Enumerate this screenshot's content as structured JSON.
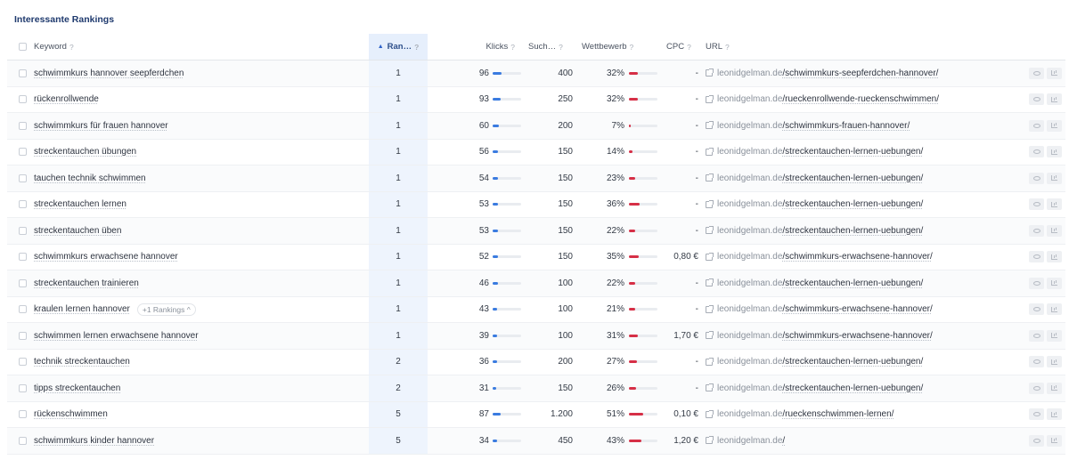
{
  "panel": {
    "title": "Interessante Rankings"
  },
  "columns": {
    "keyword": "Keyword",
    "rank": "Ran…",
    "clicks": "Klicks",
    "search": "Such…",
    "competition": "Wettbewerb",
    "cpc": "CPC",
    "url": "URL",
    "help": "?",
    "sort_icon": "▲"
  },
  "colors": {
    "rank_column": "#eef4fd",
    "clicks_bar": "#3a7be0",
    "competition_bar": "#d62f46",
    "title": "#1f3a6e"
  },
  "icons": {
    "sort": "sort-ascending-icon",
    "url": "external-link-icon",
    "view": "eye-icon",
    "stats": "chart-icon"
  },
  "rows": [
    {
      "keyword": "schwimmkurs hannover seepferdchen",
      "rank": "1",
      "clicks": "96",
      "clicks_pct": 0.3,
      "search": "400",
      "competition": "32%",
      "comp_pct": 0.32,
      "cpc": "-",
      "url_domain": "leonidgelman.de",
      "url_path": "/schwimmkurs-seepferdchen-hannover/"
    },
    {
      "keyword": "rückenrollwende",
      "rank": "1",
      "clicks": "93",
      "clicks_pct": 0.29,
      "search": "250",
      "competition": "32%",
      "comp_pct": 0.32,
      "cpc": "-",
      "url_domain": "leonidgelman.de",
      "url_path": "/rueckenrollwende-rueckenschwimmen/"
    },
    {
      "keyword": "schwimmkurs für frauen hannover",
      "rank": "1",
      "clicks": "60",
      "clicks_pct": 0.22,
      "search": "200",
      "competition": "7%",
      "comp_pct": 0.07,
      "cpc": "-",
      "url_domain": "leonidgelman.de",
      "url_path": "/schwimmkurs-frauen-hannover/"
    },
    {
      "keyword": "streckentauchen übungen",
      "rank": "1",
      "clicks": "56",
      "clicks_pct": 0.2,
      "search": "150",
      "competition": "14%",
      "comp_pct": 0.14,
      "cpc": "-",
      "url_domain": "leonidgelman.de",
      "url_path": "/streckentauchen-lernen-uebungen/"
    },
    {
      "keyword": "tauchen technik schwimmen",
      "rank": "1",
      "clicks": "54",
      "clicks_pct": 0.2,
      "search": "150",
      "competition": "23%",
      "comp_pct": 0.23,
      "cpc": "-",
      "url_domain": "leonidgelman.de",
      "url_path": "/streckentauchen-lernen-uebungen/"
    },
    {
      "keyword": "streckentauchen lernen",
      "rank": "1",
      "clicks": "53",
      "clicks_pct": 0.2,
      "search": "150",
      "competition": "36%",
      "comp_pct": 0.36,
      "cpc": "-",
      "url_domain": "leonidgelman.de",
      "url_path": "/streckentauchen-lernen-uebungen/"
    },
    {
      "keyword": "streckentauchen üben",
      "rank": "1",
      "clicks": "53",
      "clicks_pct": 0.2,
      "search": "150",
      "competition": "22%",
      "comp_pct": 0.22,
      "cpc": "-",
      "url_domain": "leonidgelman.de",
      "url_path": "/streckentauchen-lernen-uebungen/"
    },
    {
      "keyword": "schwimmkurs erwachsene hannover",
      "rank": "1",
      "clicks": "52",
      "clicks_pct": 0.19,
      "search": "150",
      "competition": "35%",
      "comp_pct": 0.35,
      "cpc": "0,80 €",
      "url_domain": "leonidgelman.de",
      "url_path": "/schwimmkurs-erwachsene-hannover/"
    },
    {
      "keyword": "streckentauchen trainieren",
      "rank": "1",
      "clicks": "46",
      "clicks_pct": 0.18,
      "search": "100",
      "competition": "22%",
      "comp_pct": 0.22,
      "cpc": "-",
      "url_domain": "leonidgelman.de",
      "url_path": "/streckentauchen-lernen-uebungen/"
    },
    {
      "keyword": "kraulen lernen hannover",
      "more": "+1 Rankings ^",
      "rank": "1",
      "clicks": "43",
      "clicks_pct": 0.17,
      "search": "100",
      "competition": "21%",
      "comp_pct": 0.21,
      "cpc": "-",
      "url_domain": "leonidgelman.de",
      "url_path": "/schwimmkurs-erwachsene-hannover/"
    },
    {
      "keyword": "schwimmen lernen erwachsene hannover",
      "rank": "1",
      "clicks": "39",
      "clicks_pct": 0.16,
      "search": "100",
      "competition": "31%",
      "comp_pct": 0.31,
      "cpc": "1,70 €",
      "url_domain": "leonidgelman.de",
      "url_path": "/schwimmkurs-erwachsene-hannover/"
    },
    {
      "keyword": "technik streckentauchen",
      "rank": "2",
      "clicks": "36",
      "clicks_pct": 0.15,
      "search": "200",
      "competition": "27%",
      "comp_pct": 0.27,
      "cpc": "-",
      "url_domain": "leonidgelman.de",
      "url_path": "/streckentauchen-lernen-uebungen/"
    },
    {
      "keyword": "tipps streckentauchen",
      "rank": "2",
      "clicks": "31",
      "clicks_pct": 0.14,
      "search": "150",
      "competition": "26%",
      "comp_pct": 0.26,
      "cpc": "-",
      "url_domain": "leonidgelman.de",
      "url_path": "/streckentauchen-lernen-uebungen/"
    },
    {
      "keyword": "rückenschwimmen",
      "rank": "5",
      "clicks": "87",
      "clicks_pct": 0.28,
      "search": "1.200",
      "competition": "51%",
      "comp_pct": 0.51,
      "cpc": "0,10 €",
      "url_domain": "leonidgelman.de",
      "url_path": "/rueckenschwimmen-lernen/"
    },
    {
      "keyword": "schwimmkurs kinder hannover",
      "rank": "5",
      "clicks": "34",
      "clicks_pct": 0.15,
      "search": "450",
      "competition": "43%",
      "comp_pct": 0.43,
      "cpc": "1,20 €",
      "url_domain": "leonidgelman.de",
      "url_path": "/"
    }
  ]
}
